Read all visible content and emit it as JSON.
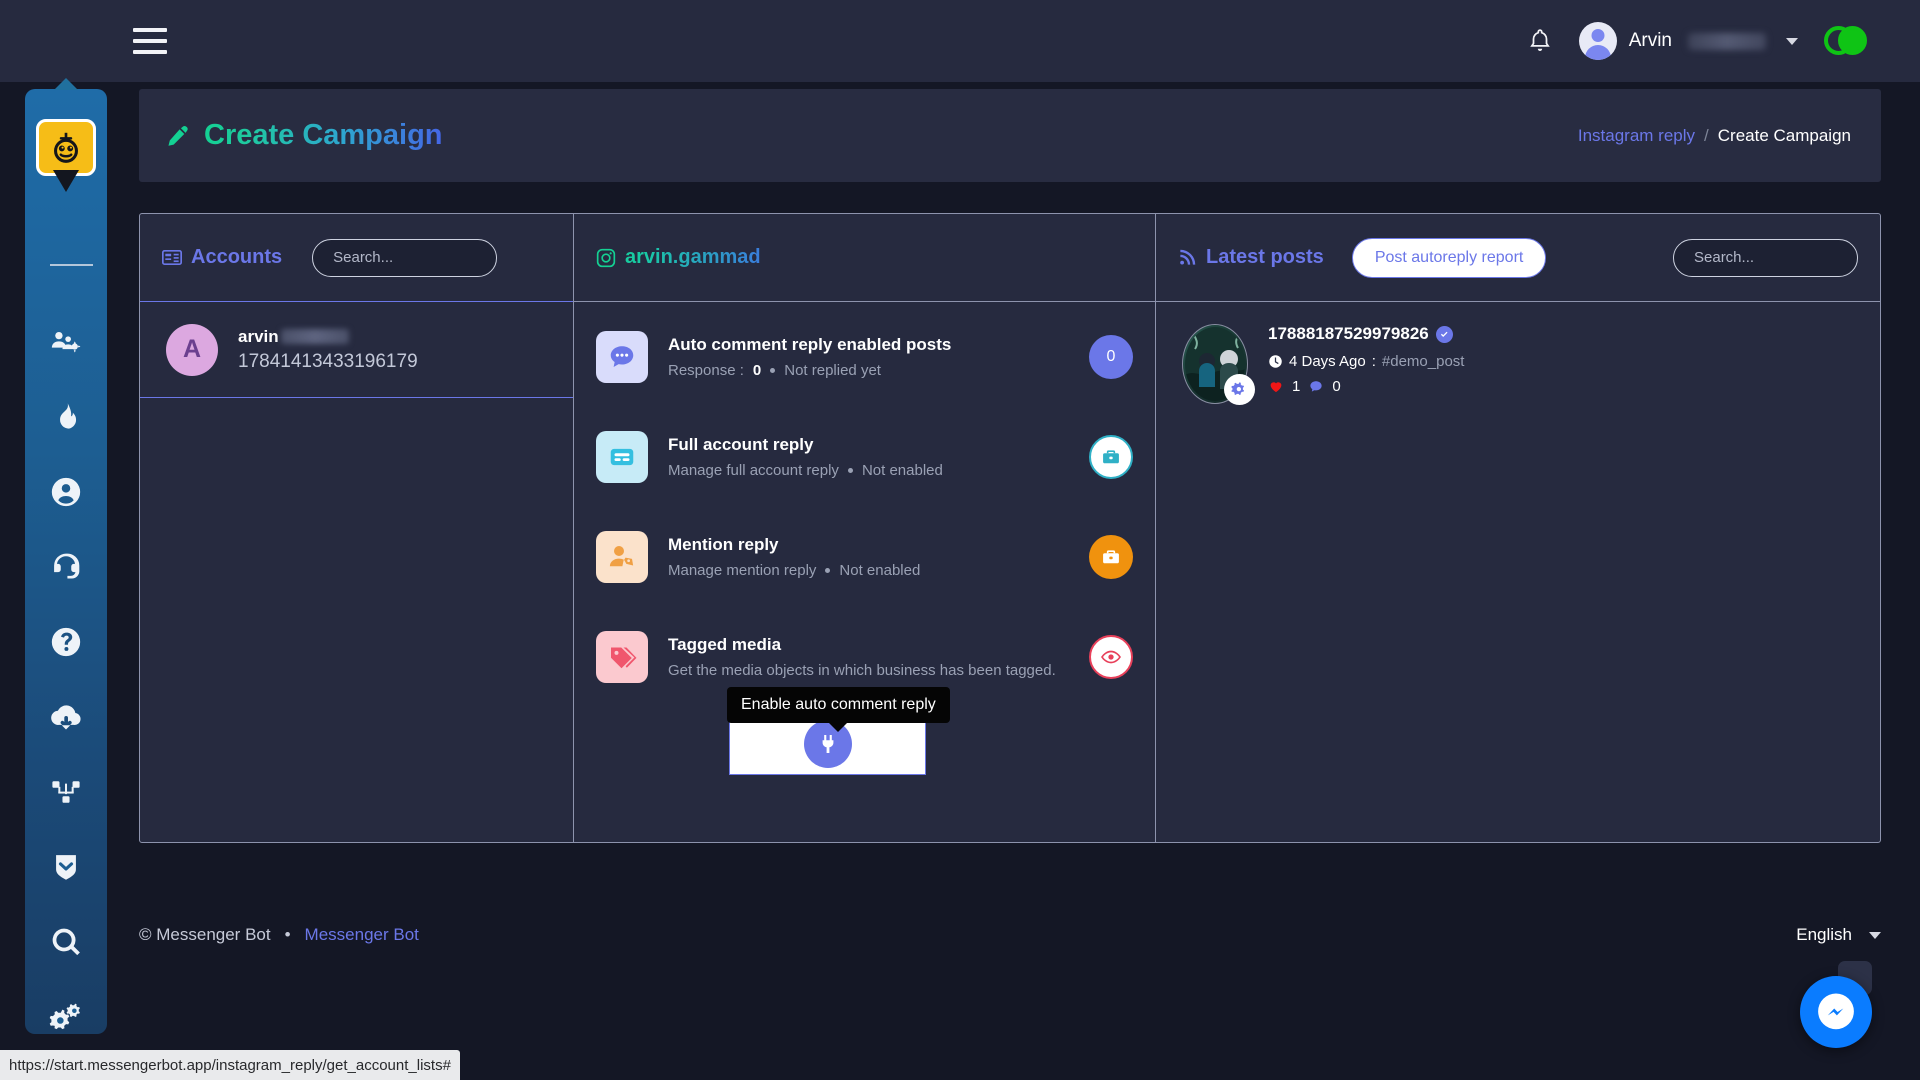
{
  "topbar": {
    "menu_icon": "hamburger-icon",
    "notification_icon": "bell-icon",
    "user_name": "Arvin",
    "dropdown_icon": "chevron-down-icon",
    "toggle_icon": "dark-mode-toggle",
    "toggle_color": "#0fc415"
  },
  "sidebar": {
    "logo": "messenger-bot-logo",
    "items": [
      {
        "icon": "users-cog-icon",
        "name": "sidebar-item-users"
      },
      {
        "icon": "fire-icon",
        "name": "sidebar-item-trending"
      },
      {
        "icon": "user-circle-icon",
        "name": "sidebar-item-profile"
      },
      {
        "icon": "headset-icon",
        "name": "sidebar-item-support"
      },
      {
        "icon": "question-circle-icon",
        "name": "sidebar-item-help"
      },
      {
        "icon": "cloud-download-icon",
        "name": "sidebar-item-downloads"
      },
      {
        "icon": "sitemap-icon",
        "name": "sidebar-item-sitemap"
      },
      {
        "icon": "shield-chevron-icon",
        "name": "sidebar-item-security"
      },
      {
        "icon": "search-icon",
        "name": "sidebar-item-search"
      },
      {
        "icon": "cogs-icon",
        "name": "sidebar-item-settings"
      }
    ]
  },
  "header": {
    "title": "Create Campaign",
    "title_icon": "pen-icon",
    "breadcrumb": {
      "parent": "Instagram reply",
      "separator": "/",
      "current": "Create Campaign"
    }
  },
  "accounts_panel": {
    "title": "Accounts",
    "title_icon": "address-card-icon",
    "search_placeholder": "Search...",
    "search_value": "",
    "rows": [
      {
        "avatar_letter": "A",
        "name": "arvin",
        "id": "17841413433196179"
      }
    ]
  },
  "features_panel": {
    "title": "arvin.gammad",
    "title_icon": "instagram-icon",
    "items": [
      {
        "icon": "comment-dots-icon",
        "icon_bg": "#d9dcfb",
        "icon_color": "#6b77e8",
        "title": "Auto comment reply enabled posts",
        "sub_prefix": "Response :",
        "sub_value": "0",
        "sub_status": "Not replied yet",
        "action": "count-badge",
        "action_label": "0"
      },
      {
        "icon": "id-card-icon",
        "icon_bg": "#c7ebf7",
        "icon_color": "#34bfe0",
        "title": "Full account reply",
        "sub_prefix": "Manage full account reply",
        "sub_value": "",
        "sub_status": "Not enabled",
        "action": "briefcase-icon",
        "action_label": ""
      },
      {
        "icon": "user-tag-icon",
        "icon_bg": "#fbe2cb",
        "icon_color": "#f0a044",
        "title": "Mention reply",
        "sub_prefix": "Manage mention reply",
        "sub_value": "",
        "sub_status": "Not enabled",
        "action": "briefcase-icon",
        "action_label": ""
      },
      {
        "icon": "tags-icon",
        "icon_bg": "#fbc9cf",
        "icon_color": "#f0566d",
        "title": "Tagged media",
        "sub_prefix": "Get the media objects in which business has been tagged.",
        "sub_value": "",
        "sub_status": "",
        "action": "eye-icon",
        "action_label": ""
      }
    ],
    "popup": {
      "tooltip": "Enable auto comment reply",
      "button_icon": "plug-icon"
    }
  },
  "posts_panel": {
    "title": "Latest posts",
    "title_icon": "rss-icon",
    "report_button": "Post autoreply report",
    "search_placeholder": "Search...",
    "search_value": "",
    "posts": [
      {
        "id": "17888187529979826",
        "verified_icon": "verified-badge-icon",
        "time_icon": "clock-icon",
        "time": "4 Days Ago",
        "time_separator": ":",
        "hashtag": "#demo_post",
        "likes_icon": "heart-icon",
        "likes": "1",
        "comments_icon": "comment-icon",
        "comments": "0",
        "settings_icon": "gear-icon"
      }
    ]
  },
  "footer": {
    "copyright": "© Messenger Bot",
    "separator": "•",
    "brand_link": "Messenger Bot",
    "language": "English",
    "language_caret": "caret-down-icon"
  },
  "chat_widget": {
    "icon": "messenger-icon",
    "color": "#0a7cff"
  },
  "status_bar": {
    "url": "https://start.messengerbot.app/instagram_reply/get_account_lists#"
  }
}
